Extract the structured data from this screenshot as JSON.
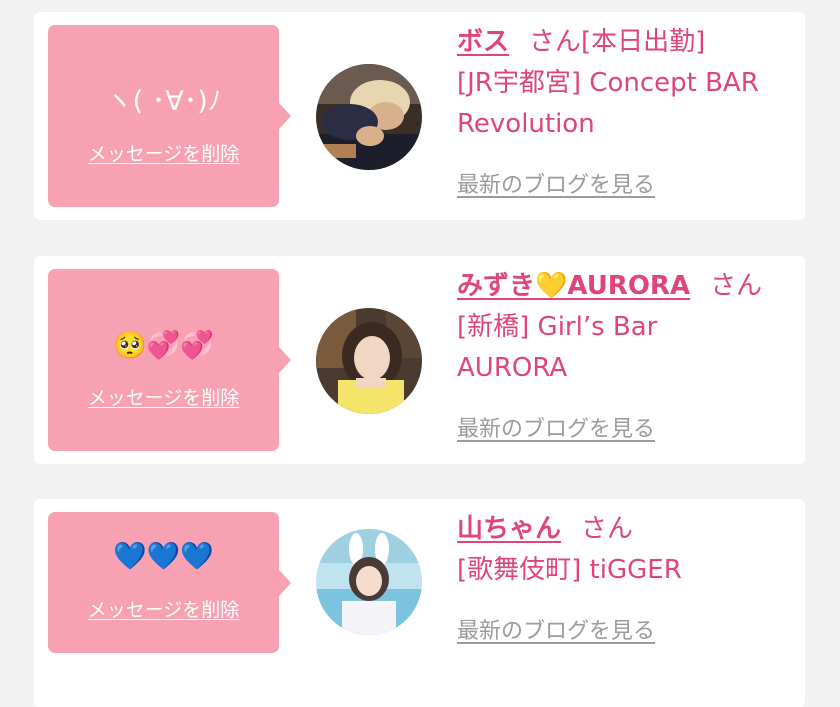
{
  "cards": [
    {
      "message": "ヽ( ･∀･)ﾉ",
      "delete_label": "メッセージを削除",
      "name": "ボス",
      "honorific": "さん",
      "lines": [
        "[本日出勤]",
        "[JR宇都宮] Concept BAR",
        "Revolution"
      ],
      "blog_label": "最新のブログを見る"
    },
    {
      "message": "🥺💞💞",
      "delete_label": "メッセージを削除",
      "name": "みずき💛AURORA",
      "honorific": "さん",
      "lines": [
        "[新橋] Girl’s Bar",
        "AURORA"
      ],
      "blog_label": "最新のブログを見る"
    },
    {
      "message": "💙💙💙",
      "delete_label": "メッセージを削除",
      "name": "山ちゃん",
      "honorific": "さん",
      "lines": [
        "[歌舞伎町] tiGGER"
      ],
      "blog_label": "最新のブログを見る"
    }
  ],
  "colors": {
    "accent": "#e0457a",
    "bubble": "#f7a1b3",
    "muted": "#9b9b9b",
    "background": "#f2f2f2"
  }
}
